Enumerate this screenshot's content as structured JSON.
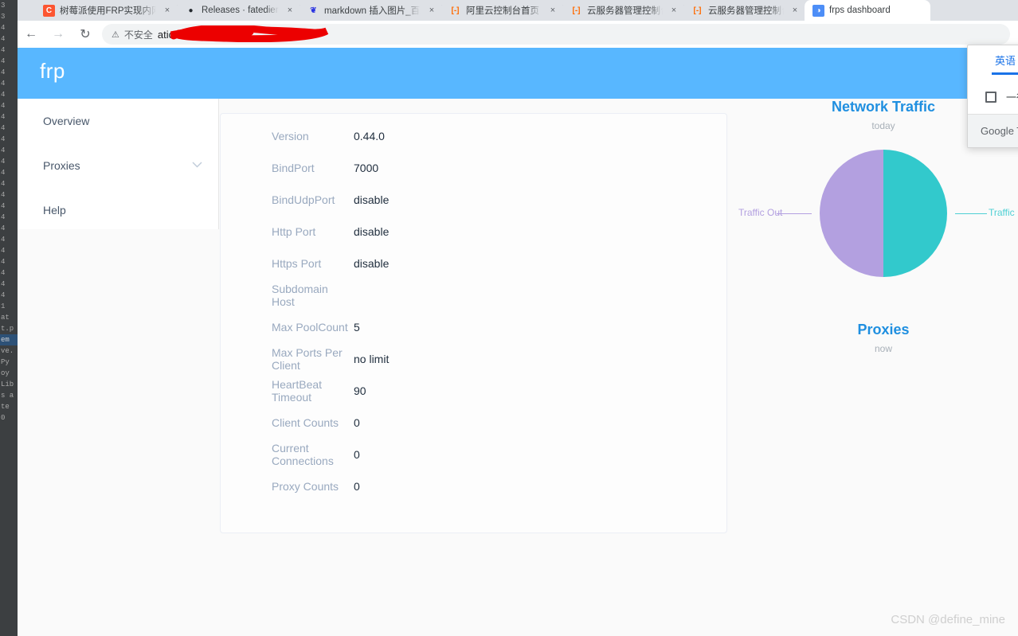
{
  "browser": {
    "tabs": [
      {
        "title": "树莓派使用FRP实现内网穿透",
        "favicon": "csdn-icon",
        "favicon_glyph": "C",
        "active": false
      },
      {
        "title": "Releases · fatedier/frp",
        "favicon": "github-icon",
        "favicon_glyph": "●",
        "active": false
      },
      {
        "title": "markdown 插入图片_百度搜索",
        "favicon": "baidu-icon",
        "favicon_glyph": "❦",
        "active": false
      },
      {
        "title": "阿里云控制台首页",
        "favicon": "aliyun-icon",
        "favicon_glyph": "[-]",
        "active": false
      },
      {
        "title": "云服务器管理控制台",
        "favicon": "aliyun-icon",
        "favicon_glyph": "[-]",
        "active": false
      },
      {
        "title": "云服务器管理控制台",
        "favicon": "aliyun-icon",
        "favicon_glyph": "[-]",
        "active": false
      },
      {
        "title": "frps dashboard",
        "favicon": "frp-icon",
        "favicon_glyph": "◑",
        "active": true
      }
    ],
    "close_label": "×",
    "nav": {
      "back": "←",
      "forward": "→",
      "reload": "↻"
    },
    "omnibox": {
      "warning_icon": "⚠",
      "security_label": "不安全",
      "url_visible": "atic/#/",
      "redacted": true
    }
  },
  "app": {
    "brand": "frp",
    "sidebar": {
      "items": [
        {
          "label": "Overview",
          "has_chevron": false
        },
        {
          "label": "Proxies",
          "has_chevron": true,
          "chevron": "⌄"
        },
        {
          "label": "Help",
          "has_chevron": false
        }
      ]
    },
    "server_info": {
      "rows": [
        {
          "key": "Version",
          "value": "0.44.0"
        },
        {
          "key": "BindPort",
          "value": "7000"
        },
        {
          "key": "BindUdpPort",
          "value": "disable"
        },
        {
          "key": "Http Port",
          "value": "disable"
        },
        {
          "key": "Https Port",
          "value": "disable"
        },
        {
          "key": "Subdomain Host",
          "value": ""
        },
        {
          "key": "Max PoolCount",
          "value": "5"
        },
        {
          "key": "Max Ports Per Client",
          "value": "no limit"
        },
        {
          "key": "HeartBeat Timeout",
          "value": "90"
        },
        {
          "key": "Client Counts",
          "value": "0"
        },
        {
          "key": "Current Connections",
          "value": "0"
        },
        {
          "key": "Proxy Counts",
          "value": "0"
        }
      ]
    }
  },
  "chart_data": [
    {
      "type": "pie",
      "title": "Network Traffic",
      "subtitle": "today",
      "categories": [
        "Traffic Out",
        "Traffic In"
      ],
      "values": [
        50,
        50
      ],
      "colors": [
        "#b3a0e0",
        "#32c9cc"
      ],
      "legend_position": "outside-labels",
      "labels": [
        {
          "text": "Traffic Out",
          "color": "#b3a0e0",
          "side": "left"
        },
        {
          "text": "Traffic In",
          "color": "#4fd0d4",
          "side": "right"
        }
      ]
    },
    {
      "type": "pie",
      "title": "Proxies",
      "subtitle": "now",
      "categories": [],
      "values": [],
      "colors": [],
      "legend_position": "none",
      "labels": []
    }
  ],
  "translate_popup": {
    "tab_label": "英语",
    "checkbox_label": "一律",
    "footer_label": "Google T",
    "accent": "#1a73e8"
  },
  "watermark": "CSDN @define_mine",
  "colors": {
    "header_blue": "#58b7ff",
    "chart_title_blue": "#1f8fe0",
    "key_gray": "#99a9bf",
    "value_dark": "#1f2d3d",
    "page_bg": "#fafafa"
  },
  "bg_editor": {
    "lines": [
      "3",
      "3",
      "4",
      "4",
      "4",
      "4",
      "4",
      "4",
      "4",
      "4",
      "4",
      "4",
      "4",
      "4",
      "4",
      "4",
      "4",
      "4",
      "4",
      "4",
      "4",
      "4",
      "4",
      "4",
      "4",
      "4",
      "4",
      "1",
      "at",
      "t.p",
      "em",
      "ve.",
      "Py",
      "oy",
      "Lib",
      "s a",
      "te",
      "0"
    ],
    "highlight_index": 30
  }
}
